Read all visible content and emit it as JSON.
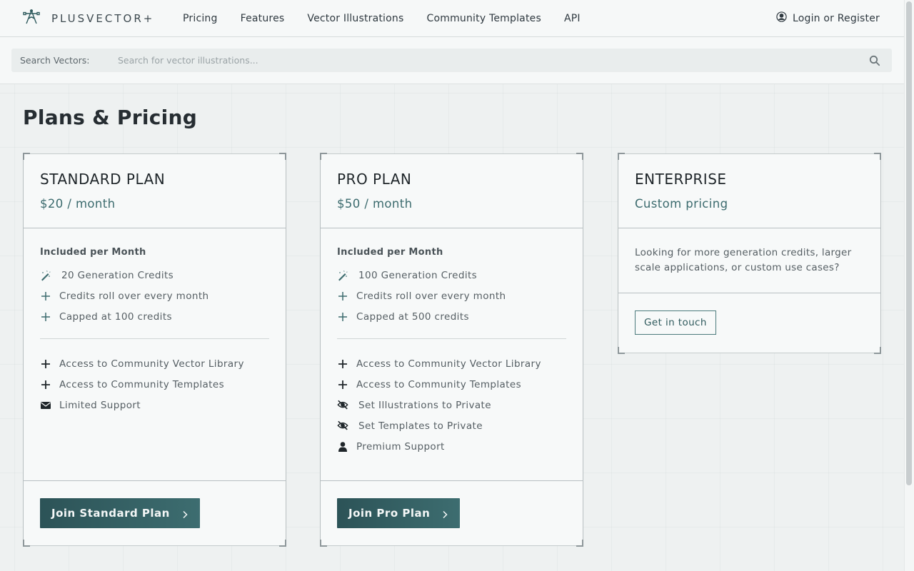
{
  "brand": {
    "name": "PLUSVECTOR+"
  },
  "nav": {
    "items": [
      {
        "label": "Pricing"
      },
      {
        "label": "Features"
      },
      {
        "label": "Vector Illustrations"
      },
      {
        "label": "Community Templates"
      },
      {
        "label": "API"
      }
    ],
    "login_label": "Login or Register"
  },
  "search": {
    "label": "Search Vectors:",
    "placeholder": "Search for vector illustrations...",
    "value": ""
  },
  "page": {
    "title": "Plans & Pricing"
  },
  "plans": [
    {
      "name": "STANDARD PLAN",
      "price": "$20 / month",
      "included_heading": "Included per Month",
      "credits": [
        "20 Generation Credits",
        "Credits roll over every month",
        "Capped at 100 credits"
      ],
      "features": [
        "Access to Community Vector Library",
        "Access to Community Templates",
        "Limited Support"
      ],
      "cta": "Join Standard Plan"
    },
    {
      "name": "PRO PLAN",
      "price": "$50 / month",
      "included_heading": "Included per Month",
      "credits": [
        "100 Generation Credits",
        "Credits roll over every month",
        "Capped at 500 credits"
      ],
      "features": [
        "Access to Community Vector Library",
        "Access to Community Templates",
        "Set Illustrations to Private",
        "Set Templates to Private",
        "Premium Support"
      ],
      "cta": "Join Pro Plan"
    },
    {
      "name": "ENTERPRISE",
      "price": "Custom pricing",
      "description": "Looking for more generation credits, larger scale applications, or custom use cases?",
      "cta": "Get in touch"
    }
  ],
  "colors": {
    "accent": "#3c6b6e",
    "button": "#2c5357"
  }
}
